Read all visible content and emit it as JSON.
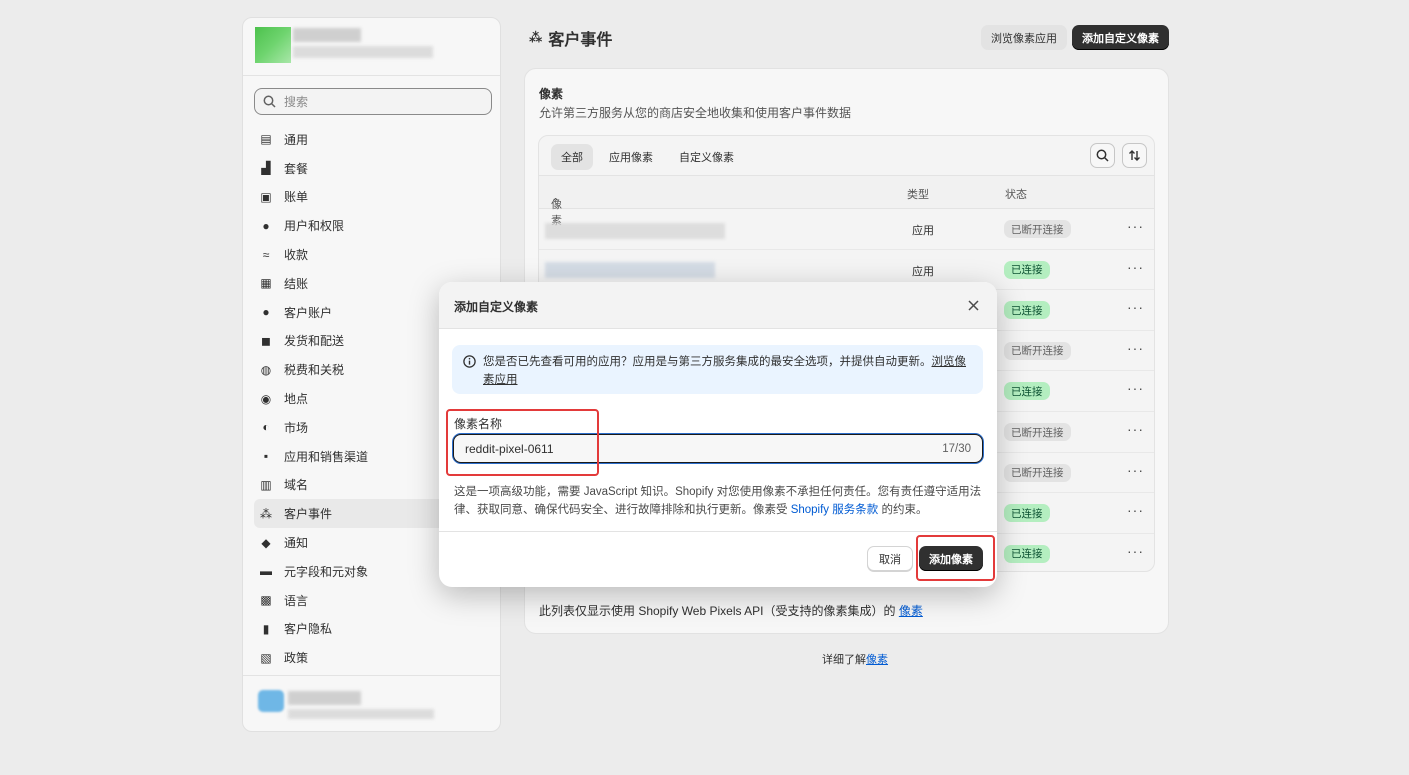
{
  "sidebar": {
    "search_placeholder": "搜索",
    "items": [
      {
        "label": "通用",
        "icon": "store-icon"
      },
      {
        "label": "套餐",
        "icon": "plan-icon"
      },
      {
        "label": "账单",
        "icon": "billing-icon"
      },
      {
        "label": "用户和权限",
        "icon": "users-icon"
      },
      {
        "label": "收款",
        "icon": "payments-icon"
      },
      {
        "label": "结账",
        "icon": "cart-icon"
      },
      {
        "label": "客户账户",
        "icon": "person-icon"
      },
      {
        "label": "发货和配送",
        "icon": "truck-icon"
      },
      {
        "label": "税费和关税",
        "icon": "tax-icon"
      },
      {
        "label": "地点",
        "icon": "location-icon"
      },
      {
        "label": "市场",
        "icon": "globe-icon"
      },
      {
        "label": "应用和销售渠道",
        "icon": "apps-icon"
      },
      {
        "label": "域名",
        "icon": "domain-icon"
      },
      {
        "label": "客户事件",
        "icon": "events-icon"
      },
      {
        "label": "通知",
        "icon": "bell-icon"
      },
      {
        "label": "元字段和元对象",
        "icon": "metafields-icon"
      },
      {
        "label": "语言",
        "icon": "language-icon"
      },
      {
        "label": "客户隐私",
        "icon": "lock-icon"
      },
      {
        "label": "政策",
        "icon": "policy-icon"
      }
    ]
  },
  "header": {
    "title": "客户事件",
    "browse_btn": "浏览像素应用",
    "add_btn": "添加自定义像素"
  },
  "card": {
    "title": "像素",
    "subtitle": "允许第三方服务从您的商店安全地收集和使用客户事件数据",
    "tabs": [
      "全部",
      "应用像素",
      "自定义像素"
    ],
    "columns": {
      "pixel": "像素",
      "type": "类型",
      "status": "状态"
    },
    "rows": [
      {
        "type": "应用",
        "status": "已断开连接",
        "on": false
      },
      {
        "type": "应用",
        "status": "已连接",
        "on": true
      },
      {
        "type": "",
        "status": "已连接",
        "on": true
      },
      {
        "type": "",
        "status": "已断开连接",
        "on": false
      },
      {
        "type": "",
        "status": "已连接",
        "on": true
      },
      {
        "type": "",
        "status": "已断开连接",
        "on": false
      },
      {
        "type": "",
        "status": "已断开连接",
        "on": false
      },
      {
        "type": "",
        "status": "已连接",
        "on": true
      },
      {
        "type": "",
        "status": "已连接",
        "on": true
      }
    ],
    "footer_text": "此列表仅显示使用 Shopify Web Pixels API（受支持的像素集成）的 ",
    "footer_link": "像素"
  },
  "learn_more": {
    "text": "详细了解",
    "link": "像素"
  },
  "modal": {
    "title": "添加自定义像素",
    "banner_text": "您是否已先查看可用的应用？应用是与第三方服务集成的最安全选项，并提供自动更新。",
    "banner_link": "浏览像素应用",
    "field_label": "像素名称",
    "field_value": "reddit-pixel-0611",
    "field_count": "17/30",
    "help_text": "这是一项高级功能，需要 JavaScript 知识。Shopify 对您使用像素不承担任何责任。您有责任遵守适用法律、获取同意、确保代码安全、进行故障排除和执行更新。像素受 ",
    "help_link": "Shopify 服务条款",
    "help_tail": " 的约束。",
    "cancel": "取消",
    "submit": "添加像素"
  },
  "colors": {
    "accent_highlight": "#e33a3a",
    "primary_button": "#303030",
    "connected_badge": "#b4eec0",
    "info_banner": "#eaf4ff"
  }
}
